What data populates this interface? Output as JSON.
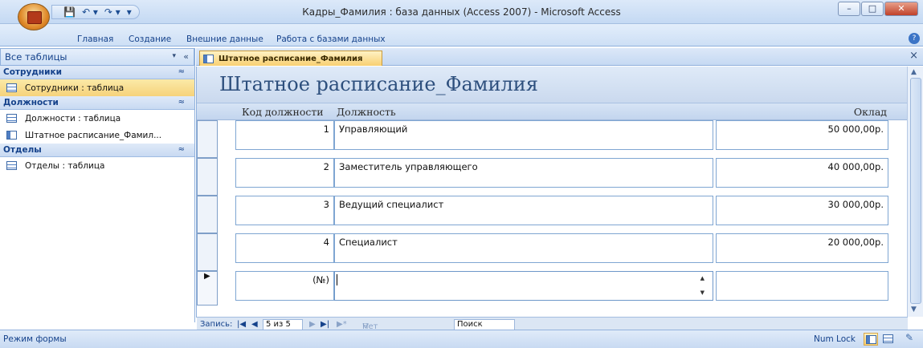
{
  "app": {
    "title": "Кадры_Фамилия : база данных (Access 2007) - Microsoft Access"
  },
  "quick_access": {
    "save": "💾",
    "undo": "↶ ▾",
    "redo": "↷ ▾",
    "customize": "▾"
  },
  "window_controls": {
    "minimize": "–",
    "maximize": "□",
    "close": "✕"
  },
  "ribbon": {
    "tabs": [
      "Главная",
      "Создание",
      "Внешние данные",
      "Работа с базами данных"
    ],
    "help": "?"
  },
  "nav_pane": {
    "header": "Все таблицы",
    "dropdown": "▾",
    "collapse": "«",
    "groups": [
      {
        "title": "Сотрудники",
        "chevron": "≈",
        "items": [
          {
            "label": "Сотрудники : таблица"
          }
        ]
      },
      {
        "title": "Должности",
        "chevron": "≈",
        "items": [
          {
            "label": "Должности : таблица"
          },
          {
            "label": "Штатное расписание_Фамил..."
          }
        ]
      },
      {
        "title": "Отделы",
        "chevron": "≈",
        "items": [
          {
            "label": "Отделы : таблица"
          }
        ]
      }
    ]
  },
  "document": {
    "tab": "Штатное расписание_Фамилия",
    "close": "×",
    "form_title": "Штатное расписание_Фамилия",
    "columns": {
      "code": "Код должности",
      "position": "Должность",
      "salary": "Оклад"
    },
    "rows": [
      {
        "code": "1",
        "position": "Управляющий",
        "salary": "50 000,00р."
      },
      {
        "code": "2",
        "position": "Заместитель управляющего",
        "salary": "40 000,00р."
      },
      {
        "code": "3",
        "position": "Ведущий специалист",
        "salary": "30 000,00р."
      },
      {
        "code": "4",
        "position": "Специалист",
        "salary": "20 000,00р."
      }
    ],
    "new_row": {
      "code": "(№)",
      "indicator": "▶",
      "spin_up": "▲",
      "spin_down": "▼"
    }
  },
  "record_nav": {
    "label": "Запись:",
    "first": "|◀",
    "prev": "◀",
    "current": "5 из 5",
    "next": "▶",
    "last": "▶|",
    "new": "▶*",
    "filter": "Нет фильтра",
    "search": "Поиск"
  },
  "scrollbar": {
    "up": "▲",
    "down": "▼"
  },
  "status_bar": {
    "mode": "Режим формы",
    "numlock": "Num Lock"
  }
}
